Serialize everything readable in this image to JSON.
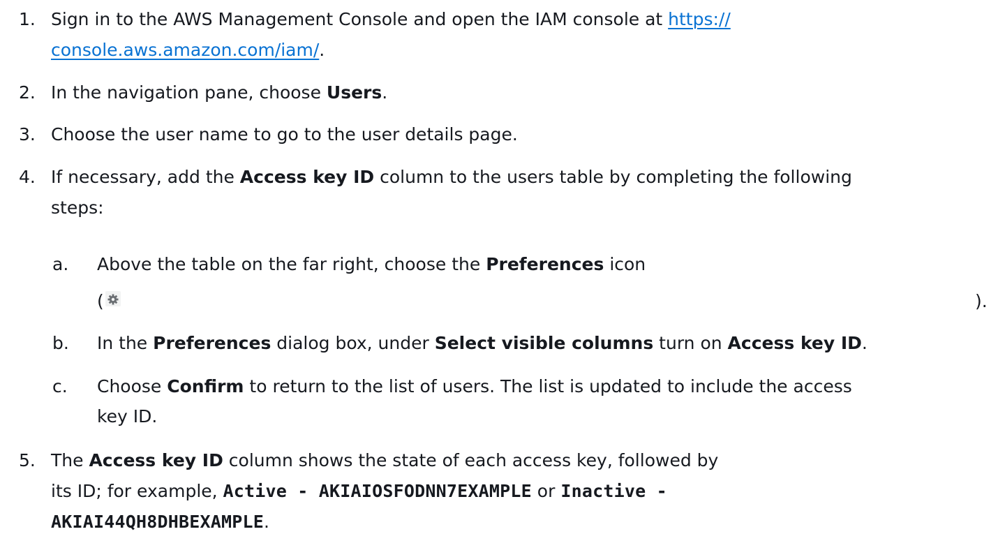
{
  "steps": {
    "s1": {
      "num": "1.",
      "pre": "Sign in to the AWS Management Console and open the IAM console at ",
      "link_line1": "https://",
      "link_line2": "console.aws.amazon.com/iam/",
      "post": "."
    },
    "s2": {
      "num": "2.",
      "pre": "In the navigation pane, choose ",
      "bold": "Users",
      "post": "."
    },
    "s3": {
      "num": "3.",
      "text": "Choose the user name to go to the user details page."
    },
    "s4": {
      "num": "4.",
      "pre": "If necessary, add the ",
      "bold": "Access key ID",
      "post_line1": " column to the users table by completing the following",
      "post_line2": "steps:",
      "a": {
        "num": "a.",
        "pre": "Above the table on the far right, choose the ",
        "bold": "Preferences",
        "post": " icon",
        "open_paren": "(",
        "close_paren": ")."
      },
      "b": {
        "num": "b.",
        "pre": "In the ",
        "bold1": "Preferences",
        "mid1": " dialog box, under ",
        "bold2": "Select visible columns",
        "mid2": " turn on ",
        "bold3": "Access key ID",
        "post": "."
      },
      "c": {
        "num": "c.",
        "pre": "Choose ",
        "bold": "Confirm",
        "post_line1": " to return to the list of users. The list is updated to include the access",
        "post_line2": "key ID."
      }
    },
    "s5": {
      "num": "5.",
      "pre": "The ",
      "bold": "Access key ID",
      "post_line1": " column shows the state of each access key, followed by",
      "line2_pre": "its ID; for example, ",
      "code1": "Active - AKIAIOSFODNN7EXAMPLE",
      "or": " or ",
      "code2_part1": "Inactive -",
      "code2_part2": "AKIAI44QH8DHBEXAMPLE",
      "post": "."
    }
  },
  "icons": {
    "preferences": "gear-icon"
  },
  "colors": {
    "text": "#16191f",
    "link": "#0972d3"
  }
}
